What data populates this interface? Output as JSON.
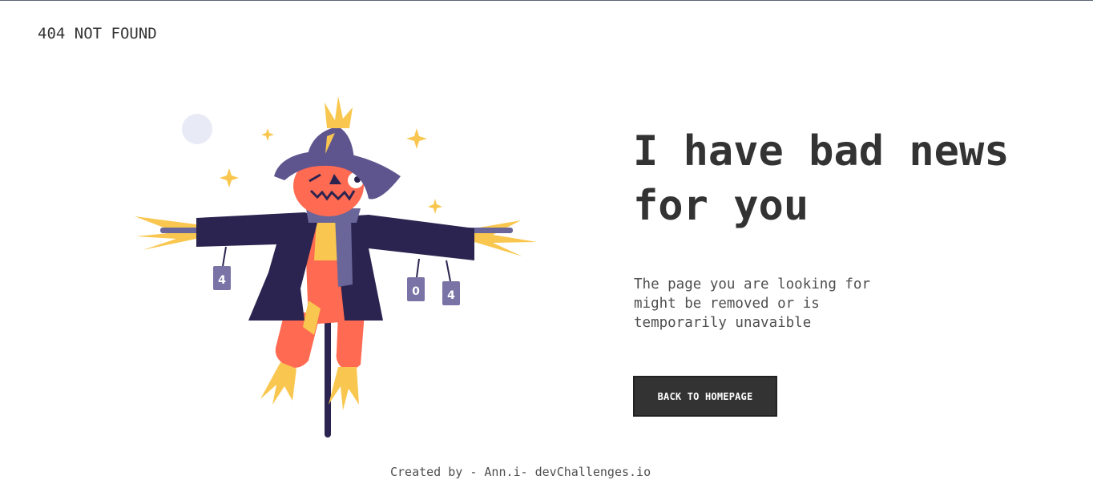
{
  "header": {
    "title": "404 NOT FOUND"
  },
  "main": {
    "headline": "I have bad news for you",
    "description": "The page you are looking for might be removed or is temporarily unavaible",
    "button_label": "BACK TO HOMEPAGE",
    "illustration": {
      "can_labels": [
        "4",
        "0",
        "4"
      ]
    }
  },
  "footer": {
    "credit": "Created by - Ann.i- devChallenges.io"
  },
  "colors": {
    "text": "#333333",
    "button_bg": "#333333",
    "button_text": "#ffffff",
    "hat": "#5e558f",
    "coat": "#2b2450",
    "head": "#ff6b52",
    "straw": "#f9c74f",
    "moon": "#e8eaf6"
  },
  "icons": {
    "illustration": "scarecrow-illustration"
  }
}
